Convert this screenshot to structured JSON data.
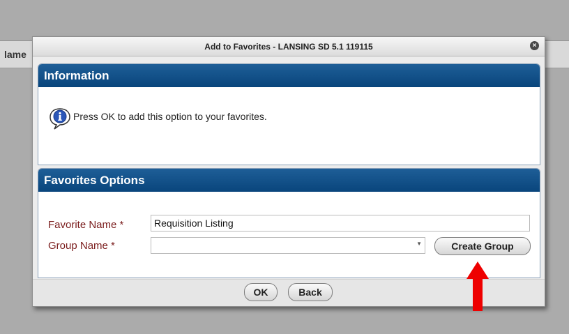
{
  "background": {
    "column_label": "lame"
  },
  "dialog": {
    "title": "Add to Favorites - LANSING SD 5.1 119115",
    "close_glyph": "×"
  },
  "info_panel": {
    "heading": "Information",
    "icon": "info-icon",
    "message": "Press OK to add this option to your favorites."
  },
  "options_panel": {
    "heading": "Favorites Options",
    "favorite_name_label": "Favorite Name *",
    "favorite_name_value": "Requisition Listing",
    "group_name_label": "Group Name *",
    "group_name_value": "",
    "create_group_label": "Create Group"
  },
  "footer": {
    "ok_label": "OK",
    "back_label": "Back"
  },
  "annotation": {
    "arrow_color": "#ee0000"
  }
}
